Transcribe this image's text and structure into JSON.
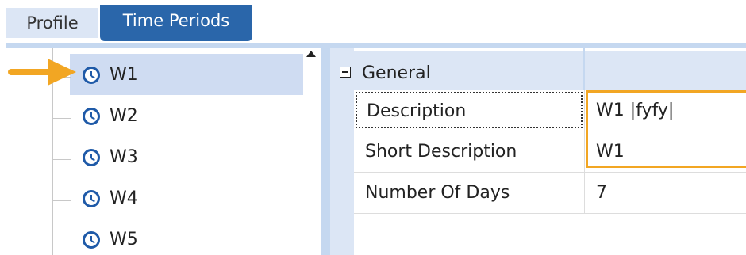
{
  "tabs": [
    {
      "label": "Profile",
      "active": false
    },
    {
      "label": "Time Periods",
      "active": true
    }
  ],
  "tree": {
    "items": [
      {
        "label": "W1",
        "icon": "clock-icon",
        "selected": true
      },
      {
        "label": "W2",
        "icon": "clock-icon",
        "selected": false
      },
      {
        "label": "W3",
        "icon": "clock-icon",
        "selected": false
      },
      {
        "label": "W4",
        "icon": "clock-icon",
        "selected": false
      },
      {
        "label": "W5",
        "icon": "clock-icon",
        "selected": false
      }
    ]
  },
  "properties": {
    "group": {
      "label": "General",
      "expander": "minus-box-icon"
    },
    "rows": [
      {
        "name": "Description",
        "value": "W1 |fyfy|"
      },
      {
        "name": "Short Description",
        "value": "W1"
      },
      {
        "name": "Number Of Days",
        "value": "7"
      }
    ]
  },
  "colors": {
    "active_tab": "#2a66aa",
    "inactive_tab": "#dce6f5",
    "selection": "#cfdcf2",
    "highlight": "#f2a623",
    "arrow": "#f2a623",
    "clock": "#1f5aa8"
  }
}
